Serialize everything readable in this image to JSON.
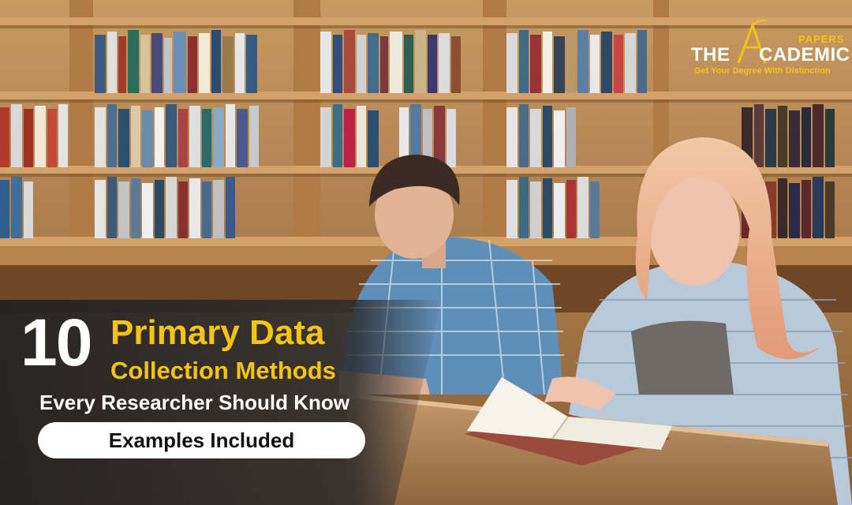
{
  "brand": {
    "top_small": "PAPERS",
    "name_left": "THE",
    "name_right": "CADEMIC",
    "tagline": "Get Your Degree With Distinction",
    "accent_color": "#f4c414"
  },
  "headline": {
    "number": "10",
    "line1": "Primary Data",
    "line2": "Collection Methods",
    "subline": "Every Researcher Should Know",
    "badge": "Examples Included"
  },
  "scene": {
    "subjects": [
      "boy-reading",
      "girl-reading",
      "open-book",
      "library-bookshelves",
      "reading-table"
    ]
  }
}
